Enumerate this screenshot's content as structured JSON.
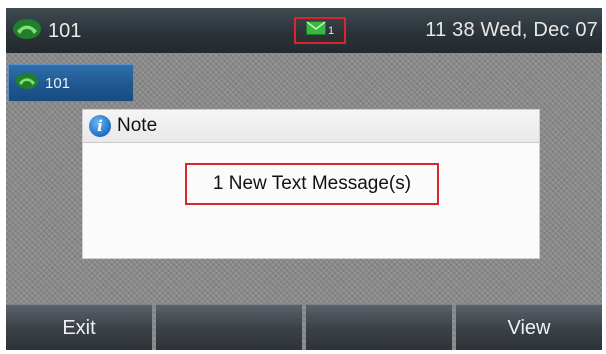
{
  "status_bar": {
    "account_label": "101",
    "message_count": "1",
    "datetime": "11 38 Wed, Dec 07"
  },
  "line_key": {
    "label": "101"
  },
  "dialog": {
    "title": "Note",
    "message": "1 New Text Message(s)"
  },
  "softkeys": [
    {
      "label": "Exit"
    },
    {
      "label": ""
    },
    {
      "label": ""
    },
    {
      "label": "View"
    }
  ],
  "colors": {
    "highlight_border": "#d8262b",
    "status_bar_bg": "#2a3238",
    "line_key_bg": "#1f5890",
    "phone_icon": "#2fae3a",
    "info_icon": "#1d6fc4"
  },
  "icons": {
    "account": "phone-handset-icon",
    "message": "envelope-icon",
    "info": "info-icon"
  }
}
